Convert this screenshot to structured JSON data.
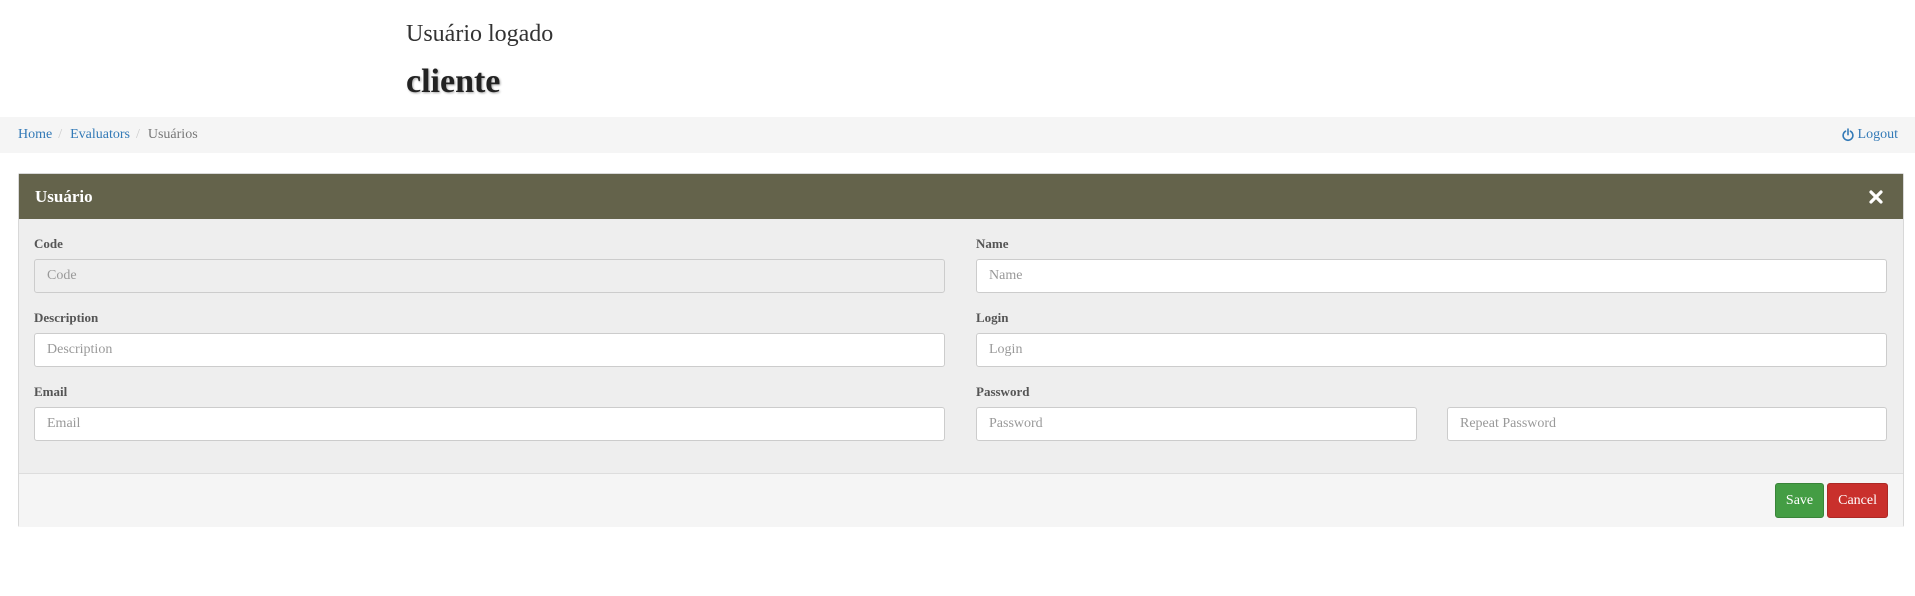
{
  "header": {
    "caption": "Usuário logado",
    "username": "cliente"
  },
  "breadcrumb": {
    "items": [
      {
        "label": "Home"
      },
      {
        "label": "Evaluators"
      },
      {
        "label": "Usuários"
      }
    ],
    "separator": "/"
  },
  "logout": {
    "label": "Logout",
    "icon": "power-icon"
  },
  "panel": {
    "title": "Usuário",
    "close_icon": "close-icon",
    "heading_color": "#64634b"
  },
  "form": {
    "code": {
      "label": "Code",
      "placeholder": "Code",
      "value": ""
    },
    "name": {
      "label": "Name",
      "placeholder": "Name",
      "value": ""
    },
    "description": {
      "label": "Description",
      "placeholder": "Description",
      "value": ""
    },
    "login": {
      "label": "Login",
      "placeholder": "Login",
      "value": ""
    },
    "email": {
      "label": "Email",
      "placeholder": "Email",
      "value": ""
    },
    "password": {
      "label": "Password",
      "placeholder": "Password",
      "value": ""
    },
    "repeat_password": {
      "placeholder": "Repeat Password",
      "value": ""
    }
  },
  "actions": {
    "save_label": "Save",
    "cancel_label": "Cancel",
    "save_color": "#449d44",
    "cancel_color": "#c9302c"
  }
}
